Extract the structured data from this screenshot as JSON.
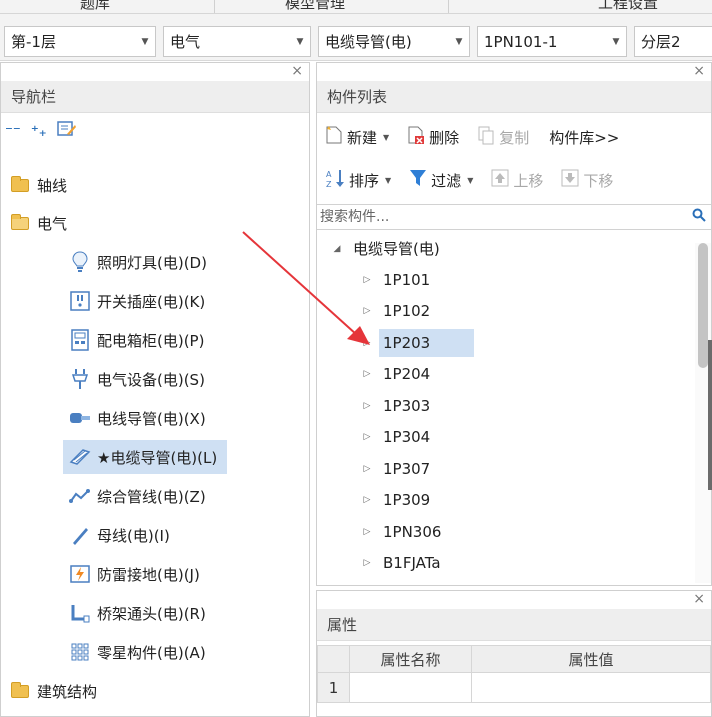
{
  "top_menu": {
    "items": [
      "题库",
      "模型管理",
      "工程设置"
    ]
  },
  "combos": [
    {
      "value": "第-1层"
    },
    {
      "value": "电气"
    },
    {
      "value": "电缆导管(电)"
    },
    {
      "value": "1PN101-1"
    },
    {
      "value": "分层2"
    }
  ],
  "nav": {
    "title": "导航栏",
    "close": "×",
    "items": [
      {
        "label": "轴线",
        "icon": "folder-collapsed-icon"
      },
      {
        "label": "电气",
        "icon": "folder-expanded-icon"
      },
      {
        "label": "照明灯具(电)(D)",
        "icon": "light-bulb-icon"
      },
      {
        "label": "开关插座(电)(K)",
        "icon": "switch-socket-icon"
      },
      {
        "label": "配电箱柜(电)(P)",
        "icon": "distribution-box-icon"
      },
      {
        "label": "电气设备(电)(S)",
        "icon": "electrical-equipment-icon"
      },
      {
        "label": "电线导管(电)(X)",
        "icon": "wire-conduit-icon"
      },
      {
        "label": "★电缆导管(电)(L)",
        "icon": "cable-conduit-icon",
        "selected": true
      },
      {
        "label": "综合管线(电)(Z)",
        "icon": "integrated-pipeline-icon"
      },
      {
        "label": "母线(电)(I)",
        "icon": "busbar-icon"
      },
      {
        "label": "防雷接地(电)(J)",
        "icon": "lightning-ground-icon"
      },
      {
        "label": "桥架通头(电)(R)",
        "icon": "tray-joint-icon"
      },
      {
        "label": "零星构件(电)(A)",
        "icon": "misc-component-icon"
      },
      {
        "label": "建筑结构",
        "icon": "folder-collapsed-icon"
      }
    ]
  },
  "components": {
    "title": "构件列表",
    "close": "×",
    "toolbar1": {
      "new": "新建",
      "delete": "删除",
      "copy": "复制",
      "library": "构件库>>"
    },
    "toolbar2": {
      "sort": "排序",
      "filter": "过滤",
      "move_up": "上移",
      "move_down": "下移"
    },
    "search_placeholder": "搜索构件...",
    "tree_root": "电缆导管(电)",
    "tree_items": [
      "1P101",
      "1P102",
      "1P203",
      "1P204",
      "1P303",
      "1P304",
      "1P307",
      "1P309",
      "1PN306",
      "B1FJATa"
    ],
    "selected_item": "1P203"
  },
  "properties": {
    "title": "属性",
    "close": "×",
    "columns": [
      "属性名称",
      "属性值"
    ],
    "rows": [
      {
        "index": "1",
        "name": "",
        "value": ""
      }
    ]
  },
  "annotation": {
    "arrow_color": "#e5353a"
  }
}
